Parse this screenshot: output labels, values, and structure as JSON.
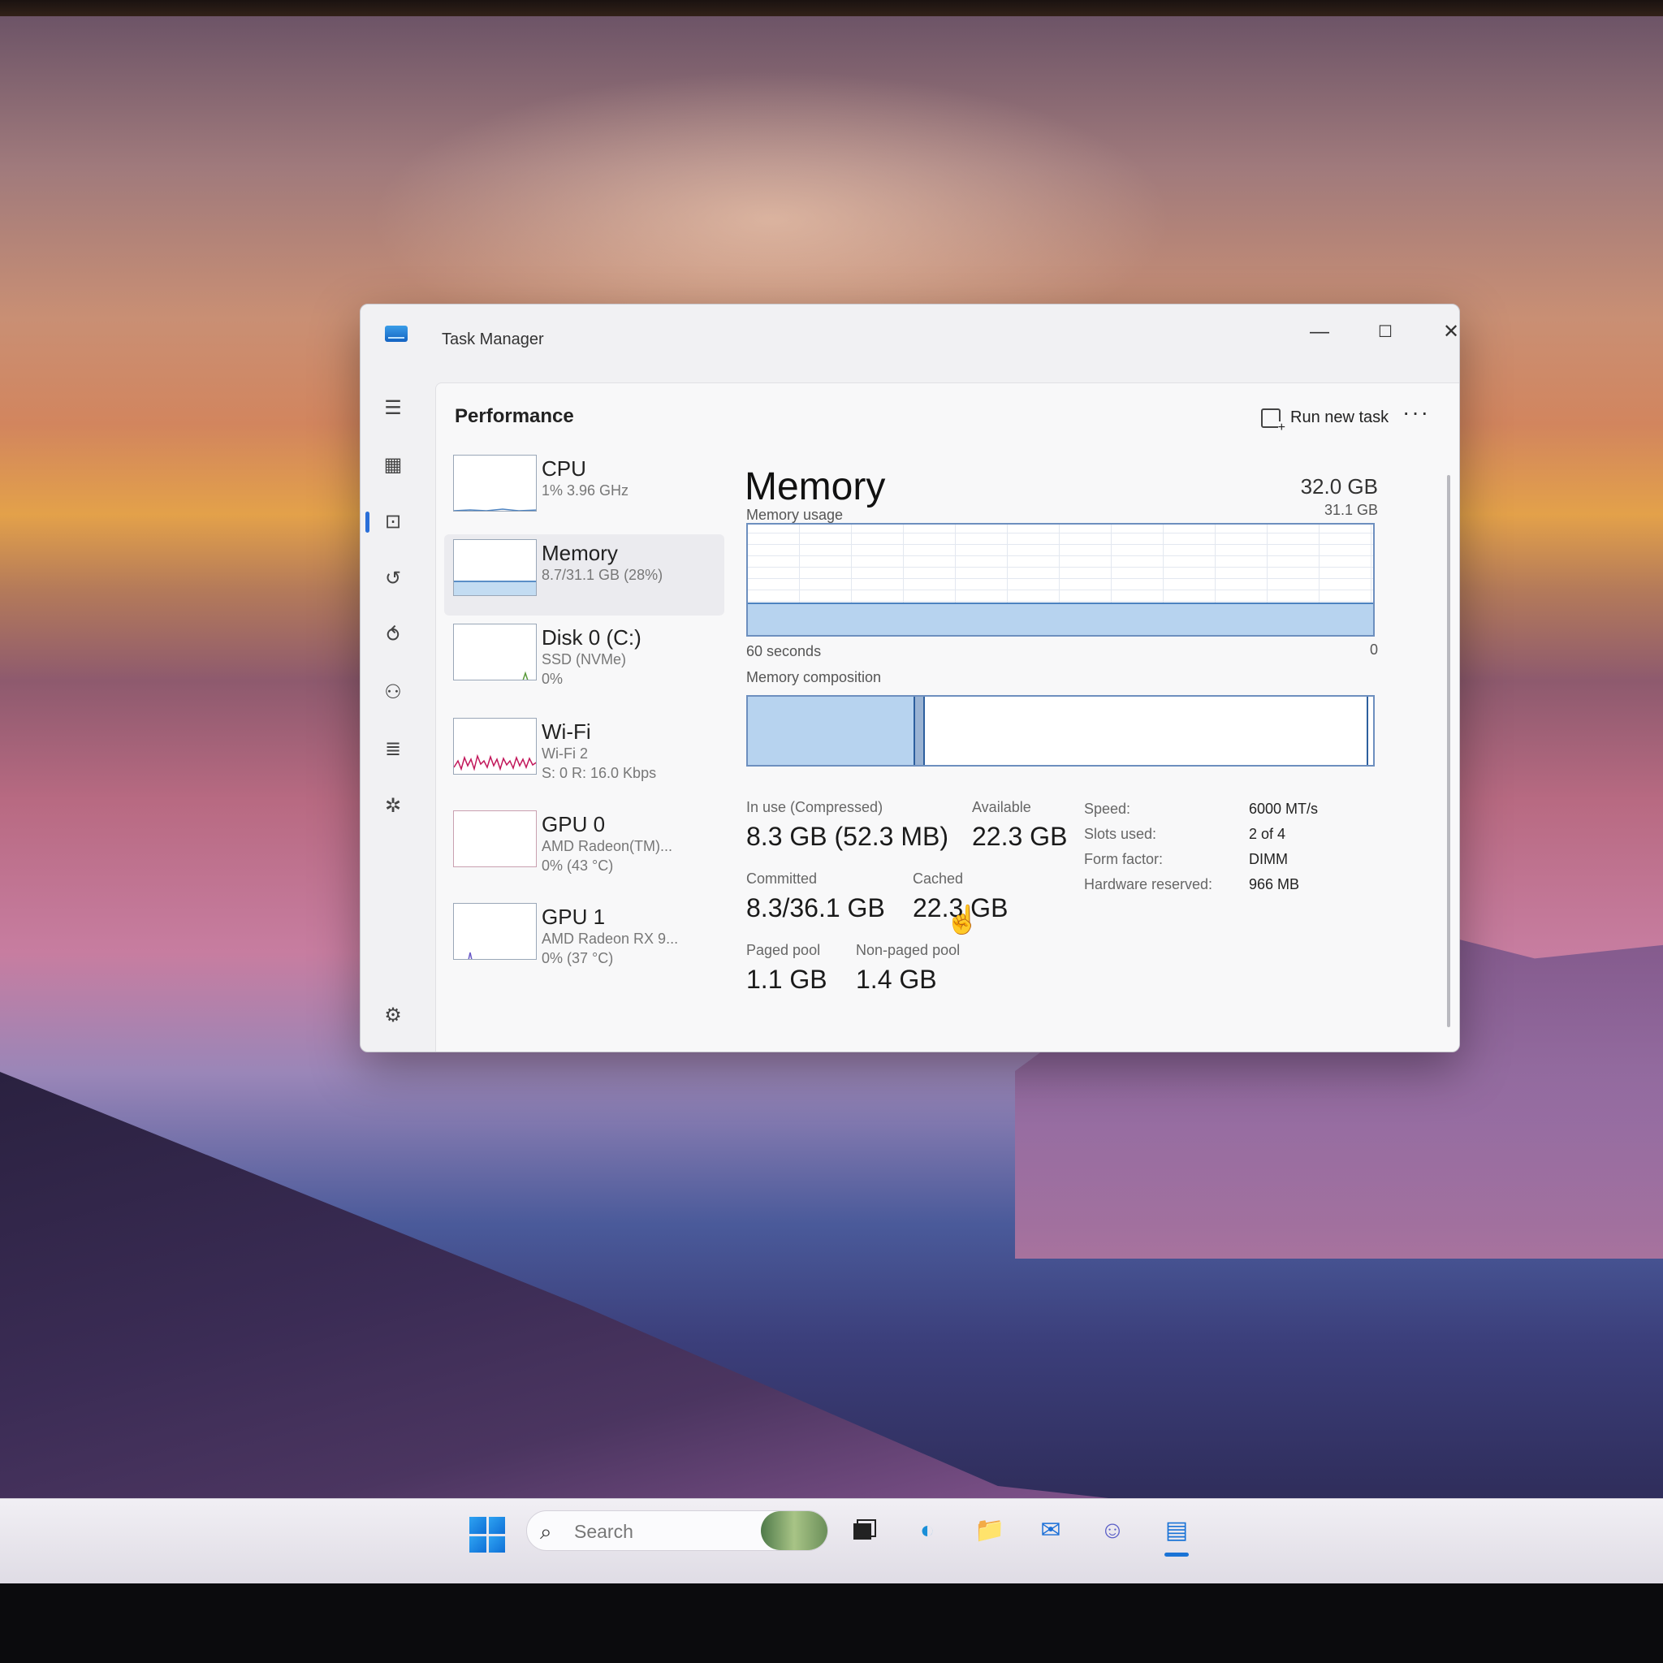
{
  "window": {
    "title": "Task Manager",
    "controls": {
      "minimize": "—",
      "maximize": "☐",
      "close": "✕"
    }
  },
  "nav": {
    "items": [
      {
        "name": "menu",
        "icon": "hamburger-icon",
        "glyph": "☰"
      },
      {
        "name": "processes",
        "icon": "processes-icon",
        "glyph": "▦"
      },
      {
        "name": "performance",
        "icon": "performance-icon",
        "glyph": "⊡",
        "selected": true
      },
      {
        "name": "app-history",
        "icon": "history-icon",
        "glyph": "↺"
      },
      {
        "name": "startup-apps",
        "icon": "startup-icon",
        "glyph": "⥀"
      },
      {
        "name": "users",
        "icon": "users-icon",
        "glyph": "⚇"
      },
      {
        "name": "details",
        "icon": "details-icon",
        "glyph": "≣"
      },
      {
        "name": "services",
        "icon": "services-icon",
        "glyph": "✲"
      }
    ],
    "settings": {
      "icon": "settings-icon",
      "glyph": "⚙"
    }
  },
  "header": {
    "page_title": "Performance",
    "run_new_task": "Run new task",
    "more": "···"
  },
  "resources": [
    {
      "name": "CPU",
      "sub1": "1% 3.96 GHz",
      "sub2": ""
    },
    {
      "name": "Memory",
      "sub1": "8.7/31.1 GB (28%)",
      "sub2": "",
      "selected": true,
      "usage_fraction": 0.28
    },
    {
      "name": "Disk 0 (C:)",
      "sub1": "SSD (NVMe)",
      "sub2": "0%"
    },
    {
      "name": "Wi-Fi",
      "sub1": "Wi-Fi 2",
      "sub2": "S: 0 R: 16.0 Kbps"
    },
    {
      "name": "GPU 0",
      "sub1": "AMD Radeon(TM)...",
      "sub2": "0% (43 °C)"
    },
    {
      "name": "GPU 1",
      "sub1": "AMD Radeon RX 9...",
      "sub2": "0% (37 °C)"
    }
  ],
  "memory": {
    "title": "Memory",
    "total": "32.0 GB",
    "usage_label": "Memory usage",
    "usage_max": "31.1 GB",
    "x_left": "60 seconds",
    "x_right": "0",
    "usage_fraction": 0.28,
    "composition_label": "Memory composition",
    "composition_inuse_fraction": 0.265,
    "stats": {
      "in_use_label": "In use (Compressed)",
      "in_use_value": "8.3 GB (52.3 MB)",
      "available_label": "Available",
      "available_value": "22.3 GB",
      "committed_label": "Committed",
      "committed_value": "8.3/36.1 GB",
      "cached_label": "Cached",
      "cached_value": "22.3 GB",
      "paged_label": "Paged pool",
      "paged_value": "1.1 GB",
      "nonpaged_label": "Non-paged pool",
      "nonpaged_value": "1.4 GB"
    },
    "specs": {
      "speed_label": "Speed:",
      "speed_value": "6000 MT/s",
      "slots_label": "Slots used:",
      "slots_value": "2 of 4",
      "form_label": "Form factor:",
      "form_value": "DIMM",
      "reserved_label": "Hardware reserved:",
      "reserved_value": "966 MB"
    }
  },
  "taskbar": {
    "search_placeholder": "Search",
    "apps": [
      {
        "icon": "file-explorer-icon",
        "glyph": "📁"
      },
      {
        "icon": "edge-icon",
        "glyph": "◐"
      },
      {
        "icon": "outlook-icon",
        "glyph": "✉"
      },
      {
        "icon": "teams-icon",
        "glyph": "☺"
      },
      {
        "icon": "task-manager-icon",
        "glyph": "▤"
      }
    ]
  },
  "colors": {
    "accent": "#2a6fd8",
    "memory_fill": "#b7d3ef",
    "memory_stroke": "#4c82c0",
    "wifi_line": "#c2185b"
  }
}
